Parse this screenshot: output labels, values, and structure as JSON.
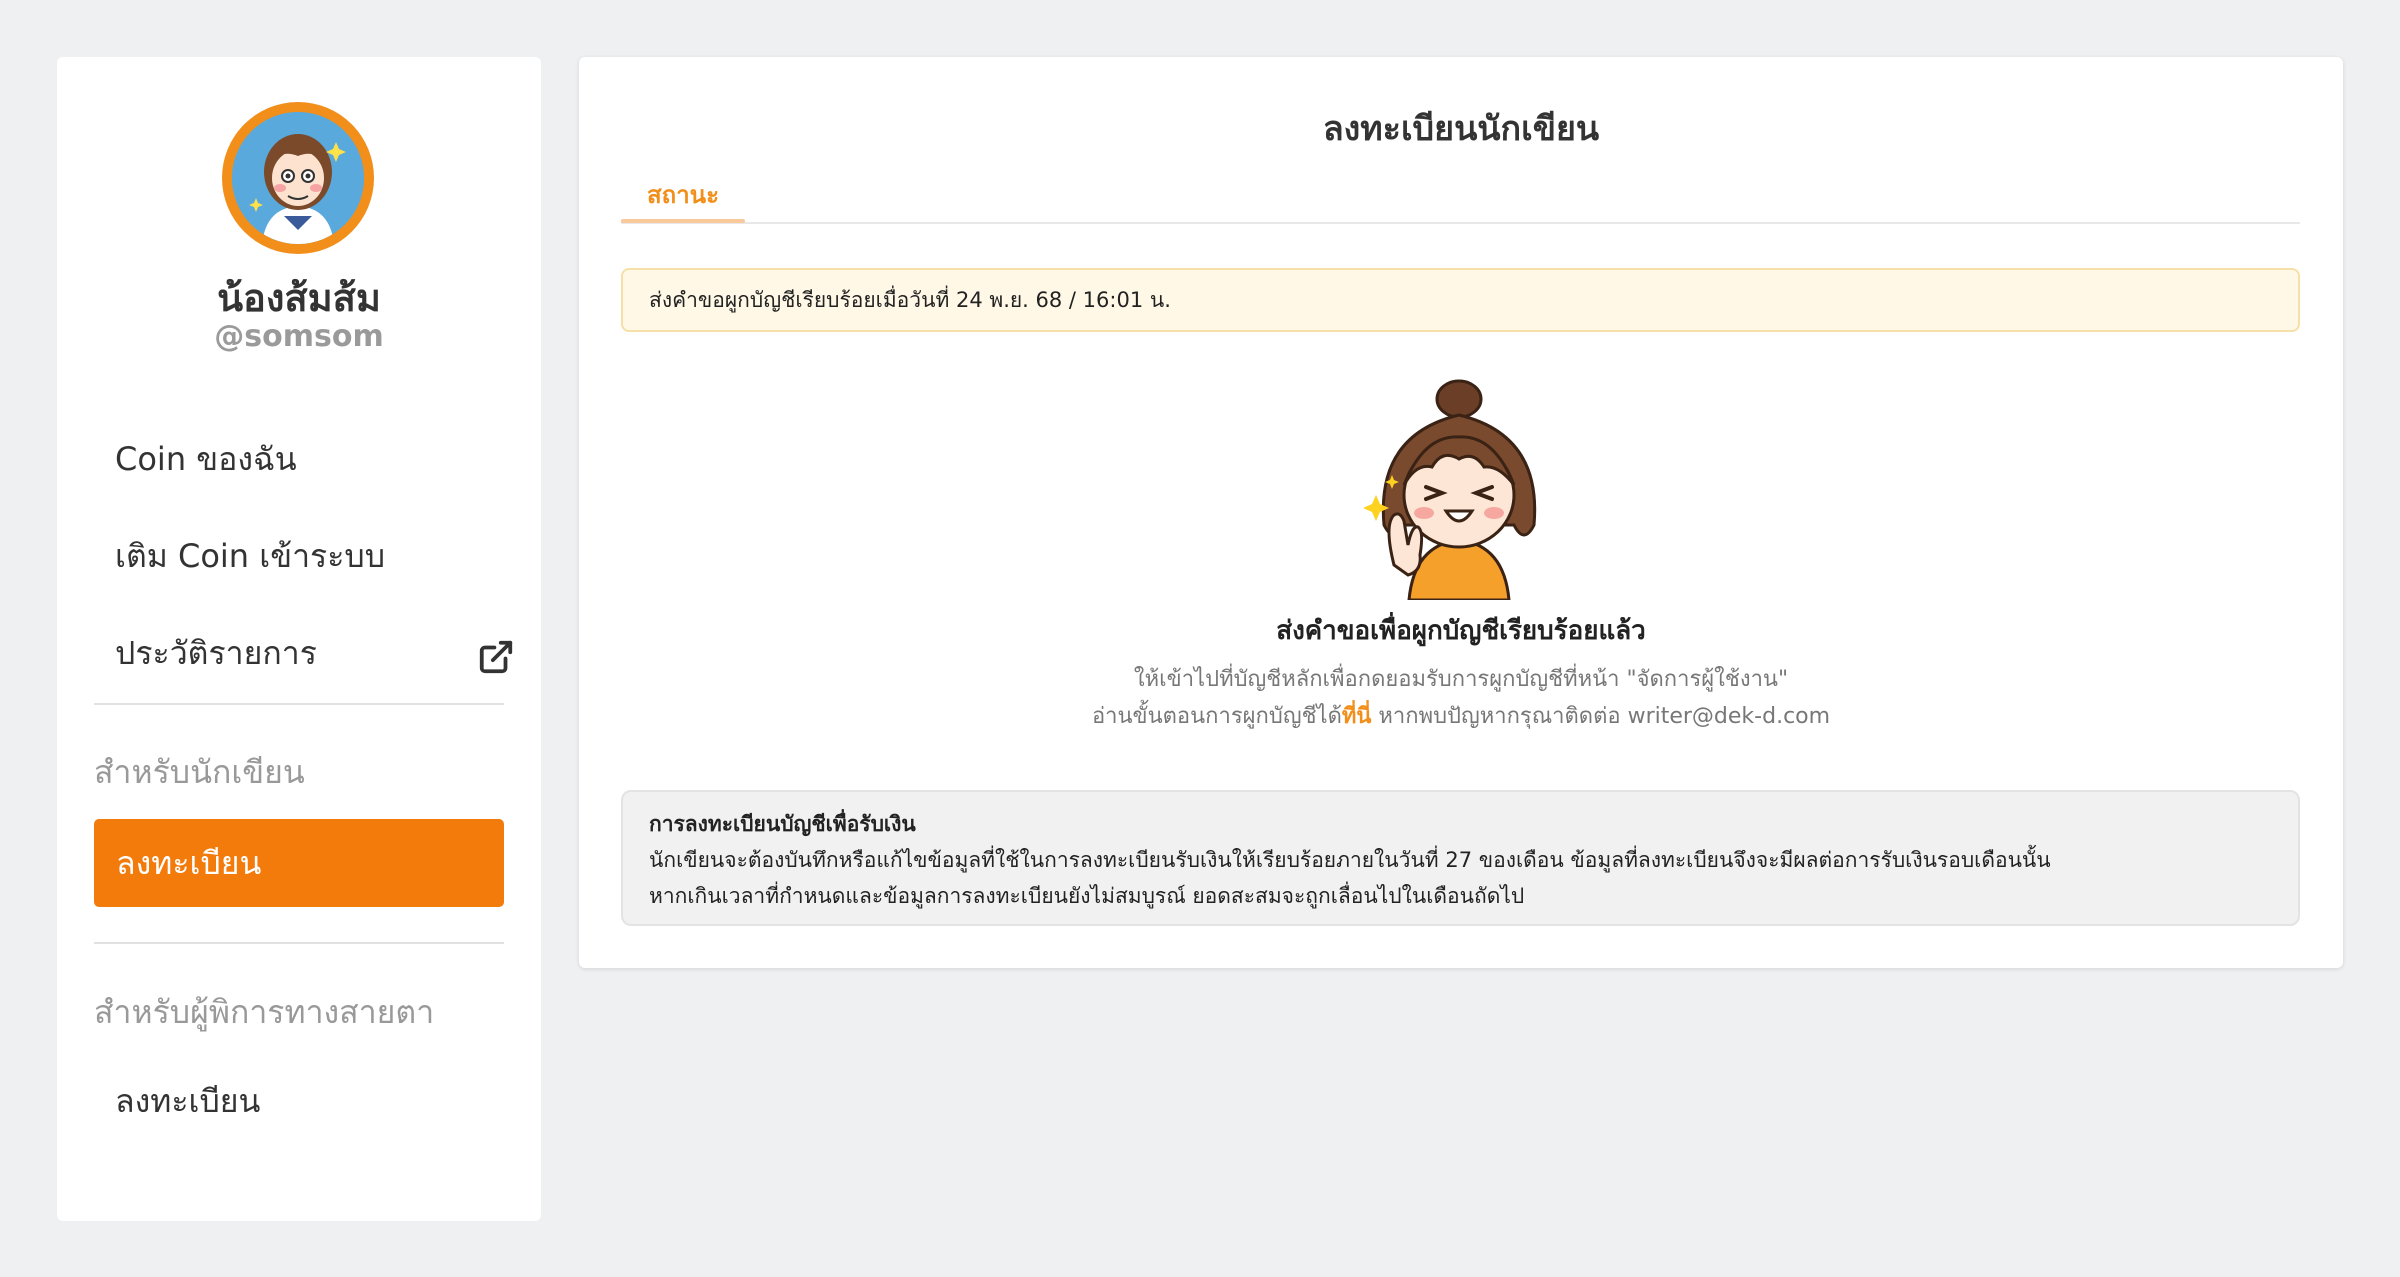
{
  "sidebar": {
    "profile_name": "น้องส้มส้ม",
    "profile_handle": "@somsom",
    "menu": {
      "my_coin": "Coin ของฉัน",
      "top_up": "เติม Coin เข้าระบบ",
      "history": "ประวัติรายการ"
    },
    "writer_section_label": "สำหรับนักเขียน",
    "writer_register": "ลงทะเบียน",
    "visually_impaired_section_label": "สำหรับผู้พิการทางสายตา",
    "visually_impaired_register": "ลงทะเบียน"
  },
  "main": {
    "title": "ลงทะเบียนนักเขียน",
    "tab_status": "สถานะ",
    "notice": "ส่งคำขอผูกบัญชีเรียบร้อยเมื่อวันที่ 24 พ.ย. 68 / 16:01 น.",
    "success_title": "ส่งคำขอเพื่อผูกบัญชีเรียบร้อยแล้ว",
    "desc_line1": "ให้เข้าไปที่บัญชีหลักเพื่อกดยอมรับการผูกบัญชีที่หน้า \"จัดการผู้ใช้งาน\"",
    "desc_line2_pre": "อ่านขั้นตอนการผูกบัญชีได้",
    "desc_line2_link": "ที่นี่",
    "desc_line2_post": " หากพบปัญหากรุณาติดต่อ writer@dek-d.com",
    "info_title": "การลงทะเบียนบัญชีเพื่อรับเงิน",
    "info_line1": "นักเขียนจะต้องบันทึกหรือแก้ไขข้อมูลที่ใช้ในการลงทะเบียนรับเงินให้เรียบร้อยภายในวันที่ 27 ของเดือน ข้อมูลที่ลงทะเบียนจึงจะมีผลต่อการรับเงินรอบเดือนนั้น",
    "info_line2": "หากเกินเวลาที่กำหนดและข้อมูลการลงทะเบียนยังไม่สมบูรณ์ ยอดสะสมจะถูกเลื่อนไปในเดือนถัดไป"
  },
  "icons": {
    "external_link": "external-link-icon"
  },
  "colors": {
    "accent": "#f27b0b",
    "notice_bg": "#fff8e6",
    "page_bg": "#eff0f2"
  }
}
